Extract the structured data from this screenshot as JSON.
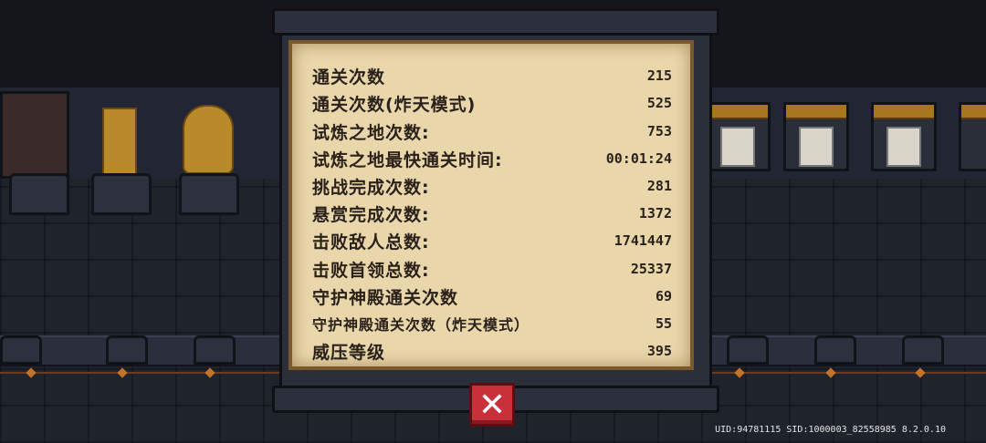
{
  "stats": [
    {
      "label": "通关次数",
      "value": "215"
    },
    {
      "label": "通关次数(炸天模式)",
      "value": "525"
    },
    {
      "label": "试炼之地次数:",
      "value": "753"
    },
    {
      "label": "试炼之地最快通关时间:",
      "value": "00:01:24"
    },
    {
      "label": "挑战完成次数:",
      "value": "281"
    },
    {
      "label": "悬赏完成次数:",
      "value": "1372"
    },
    {
      "label": "击败敌人总数:",
      "value": "1741447"
    },
    {
      "label": "击败首领总数:",
      "value": "25337"
    },
    {
      "label": "守护神殿通关次数",
      "value": "69"
    },
    {
      "label": "守护神殿通关次数（炸天模式）",
      "value": "55"
    },
    {
      "label": "威压等级",
      "value": "395"
    }
  ],
  "close_button": {
    "label": "✕"
  },
  "footer": {
    "uid_text": "UID:94781115 SID:1000003_82558985 8.2.0.10"
  },
  "colors": {
    "parchment": "#e9d7ab",
    "close": "#c8303a",
    "text": "#2a211a"
  },
  "icons": {
    "close": "close-icon"
  }
}
